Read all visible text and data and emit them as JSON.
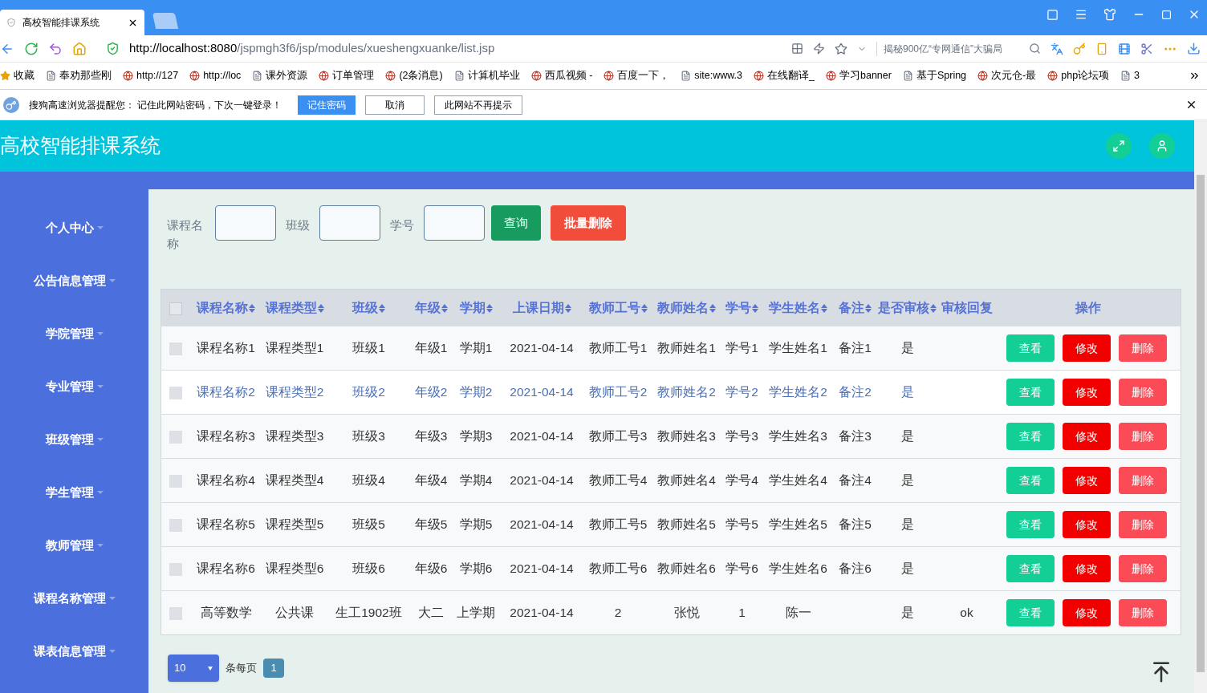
{
  "browser": {
    "tabs": [
      {
        "title": "高校智能排课系统",
        "selected": true
      },
      {
        "selected": false
      }
    ],
    "url_host": "http://localhost:8080",
    "url_path": "/jspmgh3f6/jsp/modules/xueshengxuanke/list.jsp",
    "search_hint": "揭秘900亿“专网通信”大骗局",
    "bookmarks": [
      "收藏",
      "奉劝那些刚",
      "http://127",
      "http://loc",
      "课外资源",
      "订单管理",
      "(2条消息)",
      "计算机毕业",
      "西瓜视频 -",
      "百度一下，",
      "site:www.3",
      "在线翻译_",
      "学习banner",
      "基于Spring",
      "次元仓-最",
      "php论坛项",
      "3"
    ],
    "password_bar": {
      "message": "搜狗高速浏览器提醒您： 记住此网站密码，下次一键登录！",
      "buttons": [
        "记住密码",
        "取消",
        "此网站不再提示"
      ]
    }
  },
  "app": {
    "title": "高校智能排课系统",
    "sidebar": [
      {
        "label": "个人中心",
        "selected": false
      },
      {
        "label": "公告信息管理",
        "selected": false
      },
      {
        "label": "学院管理",
        "selected": false
      },
      {
        "label": "专业管理",
        "selected": false
      },
      {
        "label": "班级管理",
        "selected": false
      },
      {
        "label": "学生管理",
        "selected": false
      },
      {
        "label": "教师管理",
        "selected": false
      },
      {
        "label": "课程名称管理",
        "selected": false
      },
      {
        "label": "课表信息管理",
        "selected": false
      }
    ],
    "filters": [
      {
        "label": "课程名称"
      },
      {
        "label": "班级"
      },
      {
        "label": "学号"
      }
    ],
    "search_button": "查询",
    "batch_delete_button": "批量删除",
    "select_all_checked": false,
    "columns": [
      {
        "label": "课程名称",
        "sortable": true
      },
      {
        "label": "课程类型",
        "sortable": true
      },
      {
        "label": "班级",
        "sortable": true
      },
      {
        "label": "年级",
        "sortable": true
      },
      {
        "label": "学期",
        "sortable": true
      },
      {
        "label": "上课日期",
        "sortable": true
      },
      {
        "label": "教师工号",
        "sortable": true
      },
      {
        "label": "教师姓名",
        "sortable": true
      },
      {
        "label": "学号",
        "sortable": true
      },
      {
        "label": "学生姓名",
        "sortable": true
      },
      {
        "label": "备注",
        "sortable": true
      },
      {
        "label": "是否审核",
        "sortable": true
      },
      {
        "label": "审核回复",
        "sortable": false
      }
    ],
    "actions_header": "操作",
    "rows": [
      {
        "highlighted": false,
        "checked": false,
        "cells": [
          "课程名称1",
          "课程类型1",
          "班级1",
          "年级1",
          "学期1",
          "2021-04-14",
          "教师工号1",
          "教师姓名1",
          "学号1",
          "学生姓名1",
          "备注1",
          "是",
          ""
        ],
        "actions": [
          {
            "label": "查看",
            "kind": "view"
          },
          {
            "label": "修改",
            "kind": "edit"
          },
          {
            "label": "删除",
            "kind": "delete"
          }
        ]
      },
      {
        "highlighted": true,
        "checked": false,
        "cells": [
          "课程名称2",
          "课程类型2",
          "班级2",
          "年级2",
          "学期2",
          "2021-04-14",
          "教师工号2",
          "教师姓名2",
          "学号2",
          "学生姓名2",
          "备注2",
          "是",
          ""
        ],
        "actions": [
          {
            "label": "查看",
            "kind": "view"
          },
          {
            "label": "修改",
            "kind": "edit"
          },
          {
            "label": "删除",
            "kind": "delete"
          }
        ]
      },
      {
        "highlighted": false,
        "checked": false,
        "cells": [
          "课程名称3",
          "课程类型3",
          "班级3",
          "年级3",
          "学期3",
          "2021-04-14",
          "教师工号3",
          "教师姓名3",
          "学号3",
          "学生姓名3",
          "备注3",
          "是",
          ""
        ],
        "actions": [
          {
            "label": "查看",
            "kind": "view"
          },
          {
            "label": "修改",
            "kind": "edit"
          },
          {
            "label": "删除",
            "kind": "delete"
          }
        ]
      },
      {
        "highlighted": false,
        "checked": false,
        "cells": [
          "课程名称4",
          "课程类型4",
          "班级4",
          "年级4",
          "学期4",
          "2021-04-14",
          "教师工号4",
          "教师姓名4",
          "学号4",
          "学生姓名4",
          "备注4",
          "是",
          ""
        ],
        "actions": [
          {
            "label": "查看",
            "kind": "view"
          },
          {
            "label": "修改",
            "kind": "edit"
          },
          {
            "label": "删除",
            "kind": "delete"
          }
        ]
      },
      {
        "highlighted": false,
        "checked": false,
        "cells": [
          "课程名称5",
          "课程类型5",
          "班级5",
          "年级5",
          "学期5",
          "2021-04-14",
          "教师工号5",
          "教师姓名5",
          "学号5",
          "学生姓名5",
          "备注5",
          "是",
          ""
        ],
        "actions": [
          {
            "label": "查看",
            "kind": "view"
          },
          {
            "label": "修改",
            "kind": "edit"
          },
          {
            "label": "删除",
            "kind": "delete"
          }
        ]
      },
      {
        "highlighted": false,
        "checked": false,
        "cells": [
          "课程名称6",
          "课程类型6",
          "班级6",
          "年级6",
          "学期6",
          "2021-04-14",
          "教师工号6",
          "教师姓名6",
          "学号6",
          "学生姓名6",
          "备注6",
          "是",
          ""
        ],
        "actions": [
          {
            "label": "查看",
            "kind": "view"
          },
          {
            "label": "修改",
            "kind": "edit"
          },
          {
            "label": "删除",
            "kind": "delete"
          }
        ]
      },
      {
        "highlighted": false,
        "checked": false,
        "cells": [
          "高等数学",
          "公共课",
          "生工1902班",
          "大二",
          "上学期",
          "2021-04-14",
          "2",
          "张悦",
          "1",
          "陈一",
          "",
          "是",
          "ok"
        ],
        "actions": [
          {
            "label": "查看",
            "kind": "view"
          },
          {
            "label": "修改",
            "kind": "edit"
          },
          {
            "label": "删除",
            "kind": "delete"
          }
        ]
      }
    ],
    "page_size": "10",
    "page_size_label": "条每页",
    "pages": [
      {
        "label": "1",
        "selected": true
      }
    ]
  }
}
